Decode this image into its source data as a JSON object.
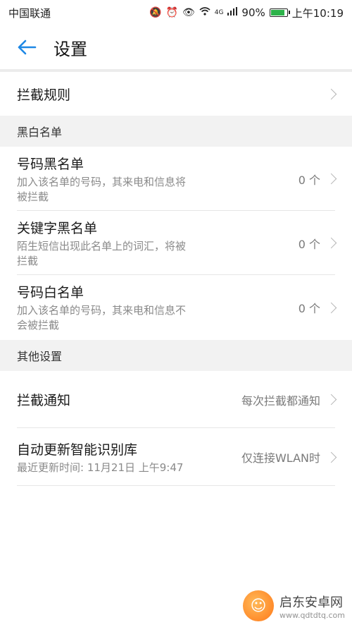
{
  "status_bar": {
    "carrier": "中国联通",
    "signal_type": "4G",
    "battery": "90%",
    "battery_level": 0.9,
    "time": "上午10:19"
  },
  "header": {
    "title": "设置"
  },
  "rules_row": {
    "title": "拦截规则"
  },
  "section_black_white": {
    "header": "黑白名单",
    "items": [
      {
        "title": "号码黑名单",
        "desc": "加入该名单的号码，其来电和信息将\n被拦截",
        "count": "0 个"
      },
      {
        "title": "关键字黑名单",
        "desc": "陌生短信出现此名单上的词汇，将被\n拦截",
        "count": "0 个"
      },
      {
        "title": "号码白名单",
        "desc": "加入该名单的号码，其来电和信息不\n会被拦截",
        "count": "0 个"
      }
    ]
  },
  "section_other": {
    "header": "其他设置",
    "items": [
      {
        "title": "拦截通知",
        "value": "每次拦截都通知"
      },
      {
        "title": "自动更新智能识别库",
        "desc": "最近更新时间: 11月21日 上午9:47",
        "value": "仅连接WLAN时"
      }
    ]
  },
  "watermark": {
    "name": "启东安卓网",
    "url": "www.qdtdtq.com"
  },
  "colors": {
    "accent": "#1e88e5",
    "section_bg": "#f2f2f2",
    "secondary_text": "#8a8a8a"
  }
}
